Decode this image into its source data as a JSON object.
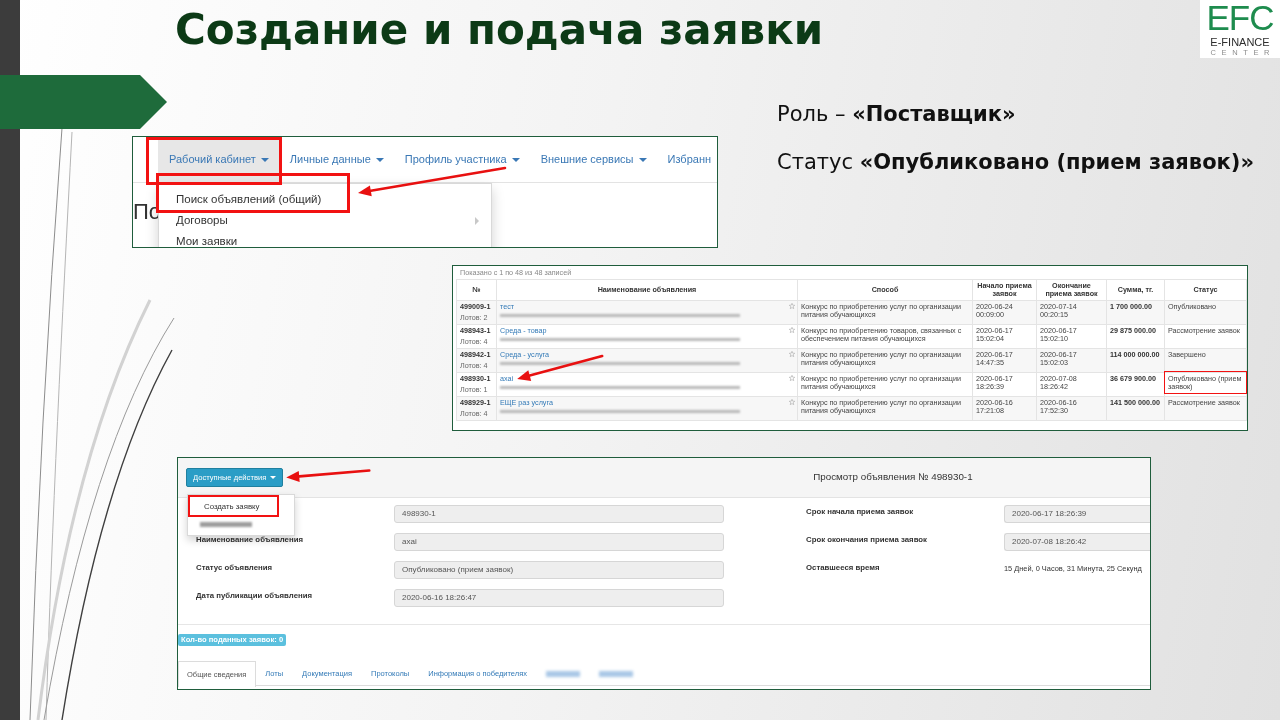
{
  "slide": {
    "title": "Создание и подача заявки",
    "logo": {
      "mark": "EFC",
      "name": "E-FINANCE",
      "tagline": "CENTER"
    }
  },
  "notes": [
    "Роль – **«Поставщик»**",
    "Статус **«Опубликовано (прием заявок)»**"
  ],
  "menu_screenshot": {
    "nav_items": [
      {
        "label": "Рабочий кабинет",
        "dropdown": true,
        "selected": true,
        "highlighted": true
      },
      {
        "label": "Личные данные",
        "dropdown": true,
        "selected": false,
        "highlighted": false
      },
      {
        "label": "Профиль участника",
        "dropdown": true,
        "selected": false,
        "highlighted": false
      },
      {
        "label": "Внешние сервисы",
        "dropdown": true,
        "selected": false,
        "highlighted": false
      },
      {
        "label": "Избранн",
        "dropdown": false,
        "selected": false,
        "highlighted": false
      }
    ],
    "page_heading": "По",
    "dropdown_items": [
      {
        "label": "Поиск объявлений (общий)",
        "submenu": false,
        "highlighted": true
      },
      {
        "label": "Договоры",
        "submenu": true,
        "highlighted": false
      },
      {
        "label": "Мои заявки",
        "submenu": false,
        "highlighted": false
      }
    ]
  },
  "table_screenshot": {
    "records_info": "Показано с 1 по 48 из 48 записей",
    "columns": [
      "№",
      "Наименование объявления",
      "Способ",
      "Начало приема заявок",
      "Окончание приема заявок",
      "Сумма, тг.",
      "Статус"
    ],
    "rows": [
      {
        "number": "499009-1",
        "lots": "Лотов: 2",
        "name": "тест",
        "method": "Конкурс по приобретению услуг по организации питания обучающихся",
        "start": "2020-06-24 00:09:00",
        "end": "2020-07-14 00:20:15",
        "amount": "1 700 000.00",
        "status": "Опубликовано",
        "highlighted": false
      },
      {
        "number": "498943-1",
        "lots": "Лотов: 4",
        "name": "Среда - товар",
        "method": "Конкурс по приобретению товаров, связанных с обеспечением питания обучающихся",
        "start": "2020-06-17 15:02:04",
        "end": "2020-06-17 15:02:10",
        "amount": "29 875 000.00",
        "status": "Рассмотрение заявок",
        "highlighted": false
      },
      {
        "number": "498942-1",
        "lots": "Лотов: 4",
        "name": "Среда - услуга",
        "method": "Конкурс по приобретению услуг по организации питания обучающихся",
        "start": "2020-06-17 14:47:35",
        "end": "2020-06-17 15:02:03",
        "amount": "114 000 000.00",
        "status": "Завершено",
        "highlighted": false
      },
      {
        "number": "498930-1",
        "lots": "Лотов: 1",
        "name": "axai",
        "method": "Конкурс по приобретению услуг по организации питания обучающихся",
        "start": "2020-06-17 18:26:39",
        "end": "2020-07-08 18:26:42",
        "amount": "36 679 900.00",
        "status": "Опубликовано (прием заявок)",
        "highlighted": true
      },
      {
        "number": "498929-1",
        "lots": "Лотов: 4",
        "name": "ЕЩЕ раз услуга",
        "method": "Конкурс по приобретению услуг по организации питания обучающихся",
        "start": "2020-06-16 17:21:08",
        "end": "2020-06-16 17:52:30",
        "amount": "141 500 000.00",
        "status": "Рассмотрение заявок",
        "highlighted": false
      }
    ]
  },
  "notice_screenshot": {
    "actions_button": "Доступные действия",
    "actions_menu": [
      {
        "kind": "item",
        "label": "Создать заявку",
        "highlighted": true
      },
      {
        "kind": "blurred",
        "highlighted": false
      }
    ],
    "title": "Просмотр объявления № 498930-1",
    "left_fields": [
      {
        "kind": "field",
        "value": "498930-1"
      },
      {
        "kind": "field",
        "label": "Наименование объявления",
        "value": "axai"
      },
      {
        "kind": "field",
        "label": "Статус объявления",
        "value": "Опубликовано (прием заявок)"
      },
      {
        "kind": "field",
        "label": "Дата публикации объявления",
        "value": "2020-06-16 18:26:47"
      }
    ],
    "right_fields": [
      {
        "kind": "field",
        "label": "Срок начала приема заявок",
        "value": "2020-06-17 18:26:39"
      },
      {
        "kind": "field",
        "label": "Срок окончания приема заявок",
        "value": "2020-07-08 18:26:42"
      },
      {
        "kind": "text",
        "label": "Оставшееся время",
        "value": "15 Дней, 0 Часов, 31 Минута, 25 Секунд"
      }
    ],
    "count_badge": "Кол-во поданных заявок: 0",
    "tabs": [
      {
        "kind": "tab",
        "label": "Общие сведения",
        "selected": true
      },
      {
        "kind": "tab",
        "label": "Лоты",
        "selected": false
      },
      {
        "kind": "tab",
        "label": "Документация",
        "selected": false
      },
      {
        "kind": "tab",
        "label": "Протоколы",
        "selected": false
      },
      {
        "kind": "tab",
        "label": "Информация о победителях",
        "selected": false
      },
      {
        "kind": "blurred",
        "selected": false
      },
      {
        "kind": "blurred",
        "selected": false
      }
    ]
  }
}
